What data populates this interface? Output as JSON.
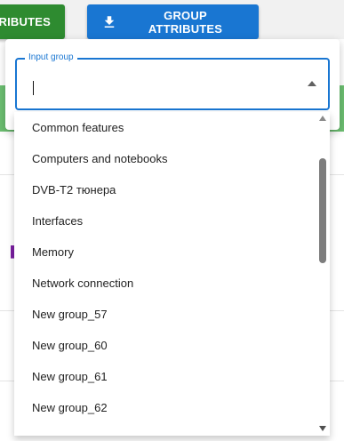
{
  "toolbar": {
    "left_button_label": "ATTRIBUTES",
    "group_attributes_label": "GROUP ATTRIBUTES"
  },
  "popup": {
    "field_label": "Input group",
    "input_value": "",
    "options": [
      "Common features",
      "Computers and notebooks",
      "DVB-T2 тюнера",
      "Interfaces",
      "Memory",
      "Network connection",
      "New group_57",
      "New group_60",
      "New group_61",
      "New group_62"
    ]
  },
  "colors": {
    "primary_blue": "#1976d2",
    "green_button": "#2e8b30",
    "green_band": "#6cbf71"
  },
  "icons": [
    "download-icon",
    "dropdown-arrow-icon",
    "scroll-up-arrow-icon",
    "scroll-down-arrow-icon"
  ]
}
